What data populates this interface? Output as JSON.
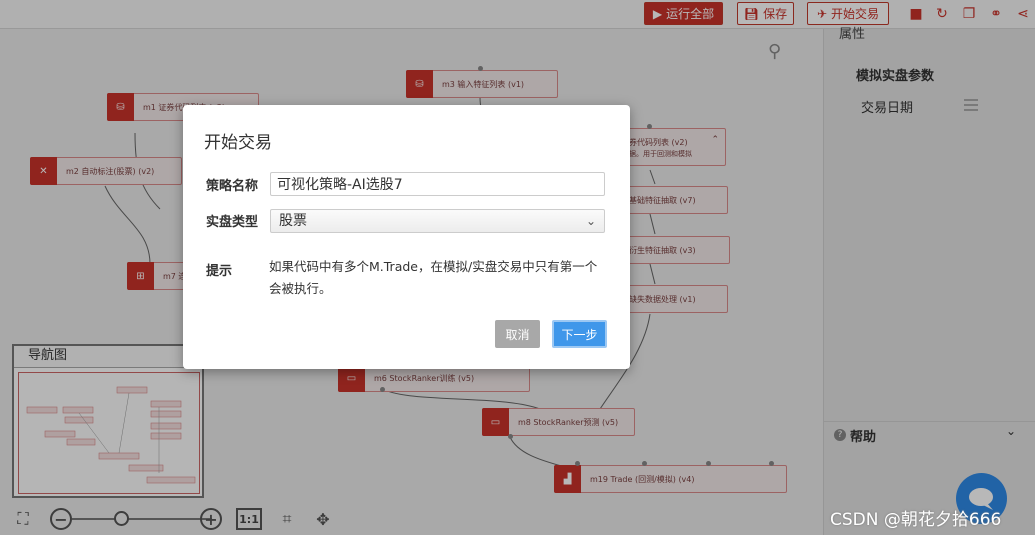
{
  "toolbar": {
    "run_label": "运行全部",
    "save_label": "保存",
    "trade_label": "开始交易"
  },
  "nodes": {
    "m1": "m1 证券代码列表 (v2)",
    "m3": "m3 输入特征列表 (v1)",
    "m2": "m2 自动标注(股票) (v2)",
    "m7": "m7 连",
    "right1": "券代码列表 (v2)",
    "right1_sub": "据。用于回测和模拟",
    "right2": "基础特征抽取 (v7)",
    "right3": "衍生特征抽取 (v3)",
    "right4": "缺失数据处理 (v1)",
    "m6": "m6 StockRanker训练 (v5)",
    "m8": "m8 StockRanker预测 (v5)",
    "m19": "m19 Trade (回测/模拟) (v4)"
  },
  "navigator": {
    "title": "导航图"
  },
  "zoom": {
    "one_to_one": "1:1",
    "level": 0.35
  },
  "right_panel": {
    "top_label": "属性",
    "group_title": "模拟实盘参数",
    "field_label": "交易日期",
    "help_label": "帮助"
  },
  "modal": {
    "title": "开始交易",
    "strategy_name_label": "策略名称",
    "strategy_name_value": "可视化策略-AI选股7",
    "trade_type_label": "实盘类型",
    "trade_type_value": "股票",
    "tip_label": "提示",
    "tip_text": "如果代码中有多个M.Trade，在模拟/实盘交易中只有第一个会被执行。",
    "cancel_label": "取消",
    "next_label": "下一步"
  },
  "watermark": "CSDN @朝花夕拾666"
}
